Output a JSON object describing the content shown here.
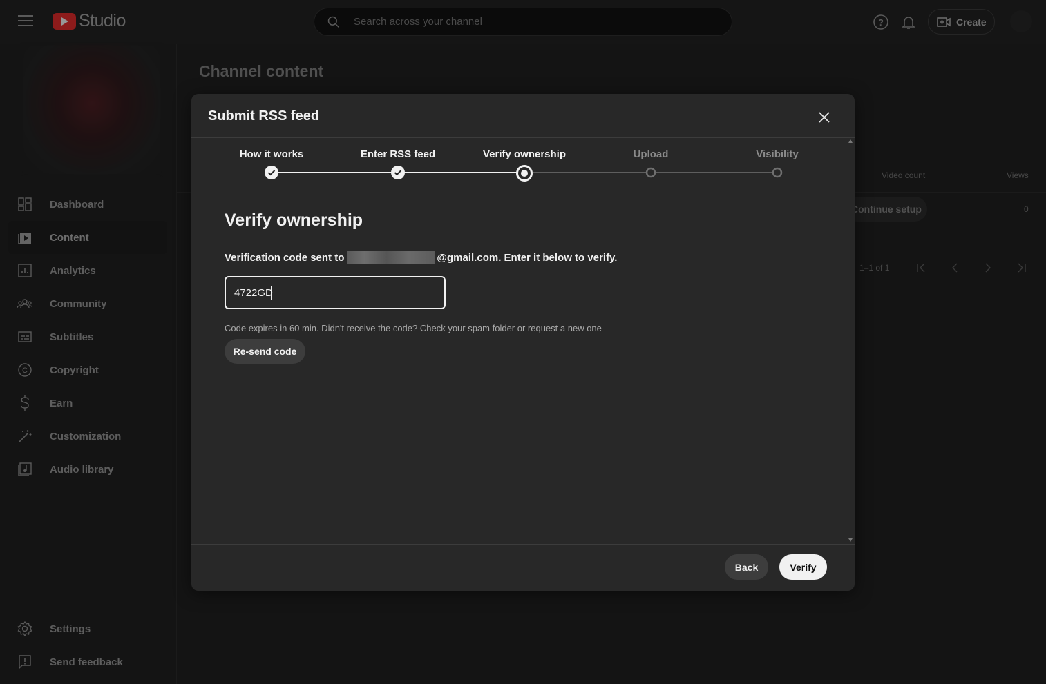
{
  "header": {
    "logo_text": "Studio",
    "search_placeholder": "Search across your channel",
    "create_label": "Create",
    "icons": [
      "menu-icon",
      "youtube-logo-icon",
      "search-icon",
      "help-icon",
      "bell-icon",
      "create-video-icon"
    ]
  },
  "sidebar": {
    "items": [
      {
        "label": "Dashboard",
        "icon": "dashboard-icon"
      },
      {
        "label": "Content",
        "icon": "content-icon",
        "active": true
      },
      {
        "label": "Analytics",
        "icon": "analytics-icon"
      },
      {
        "label": "Community",
        "icon": "community-icon"
      },
      {
        "label": "Subtitles",
        "icon": "subtitles-icon"
      },
      {
        "label": "Copyright",
        "icon": "copyright-icon"
      },
      {
        "label": "Earn",
        "icon": "dollar-icon"
      },
      {
        "label": "Customization",
        "icon": "magic-wand-icon"
      },
      {
        "label": "Audio library",
        "icon": "audio-library-icon"
      }
    ],
    "bottom_items": [
      {
        "label": "Settings",
        "icon": "gear-icon"
      },
      {
        "label": "Send feedback",
        "icon": "feedback-icon"
      }
    ]
  },
  "main": {
    "title": "Channel content",
    "columns": {
      "video_count": "Video count",
      "views": "Views"
    },
    "row": {
      "action": "Continue setup",
      "views": "0"
    },
    "pagination": "1–1 of 1"
  },
  "dialog": {
    "title": "Submit RSS feed",
    "steps": [
      {
        "label": "How it works",
        "state": "done"
      },
      {
        "label": "Enter RSS feed",
        "state": "done"
      },
      {
        "label": "Verify ownership",
        "state": "current"
      },
      {
        "label": "Upload",
        "state": "todo"
      },
      {
        "label": "Visibility",
        "state": "todo"
      }
    ],
    "heading": "Verify ownership",
    "desc_prefix": "Verification code sent to",
    "email_suffix": "@gmail.com",
    "desc_suffix": ". Enter it below to verify.",
    "code_value": "4722GD",
    "helper": "Code expires in 60 min. Didn't receive the code? Check your spam folder or request a new one",
    "resend_label": "Re-send code",
    "back_label": "Back",
    "verify_label": "Verify"
  },
  "colors": {
    "background": "#1f1f1f",
    "dialog": "#282828",
    "brand_red": "#d92a2a",
    "text": "#f1f1f1"
  }
}
